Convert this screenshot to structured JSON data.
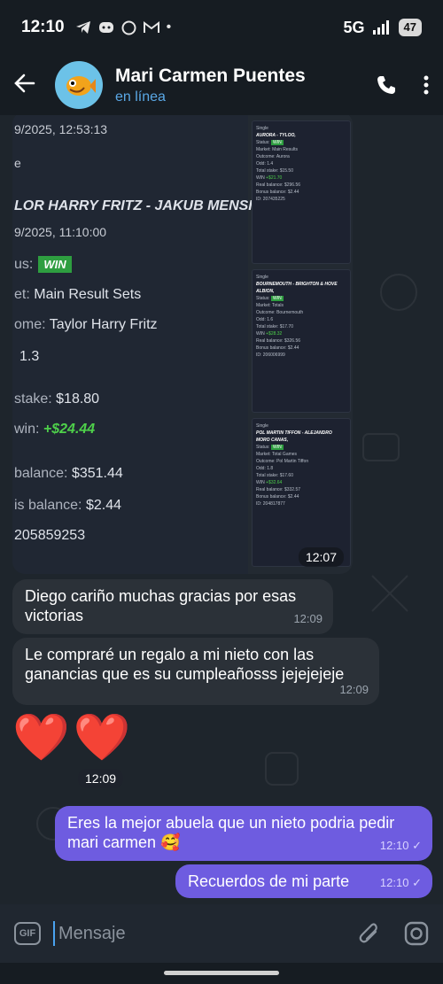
{
  "status_bar": {
    "time": "12:10",
    "network": "5G",
    "battery": "47"
  },
  "header": {
    "title": "Mari Carmen Puentes",
    "subtitle": "en línea"
  },
  "photo": {
    "left_lines": [
      "9/2025, 12:53:13",
      "e",
      "LOR HARRY FRITZ - JAKUB MENSIK,",
      "9/2025, 11:10:00",
      "us:",
      "et:",
      "Main Result Sets",
      "ome:",
      "Taylor Harry Fritz",
      "1.3",
      "stake:",
      "$18.80",
      "win:",
      "+$24.44",
      "balance:",
      "$351.44",
      "is balance:",
      "$2.44",
      "205859253"
    ],
    "win_label": "WIN",
    "time": "12:07",
    "tickets": [
      {
        "title": "AURORA - TYLOO,",
        "market": "Main Results",
        "outcome": "Aurora",
        "odd": "1.4",
        "stake": "$15.50",
        "win": "+$21.70",
        "balance": "$296.56",
        "bonus": "$2.44",
        "id": "207435225"
      },
      {
        "title": "BOURNEMOUTH - BRIGHTON & HOVE ALBION,",
        "market": "Totals",
        "outcome": "Bournemouth",
        "odd": "1.6",
        "stake": "$17.70",
        "win": "+$28.32",
        "balance": "$326.56",
        "bonus": "$2.44",
        "id": "206006999"
      },
      {
        "title": "POL MARTIN TIFFON - ALEJANDRO MORO CANAS,",
        "market": "Total Games",
        "outcome": "Pol Martin Tiffon",
        "odd": "1.8",
        "stake": "$17.60",
        "win": "+$32.64",
        "balance": "$332.57",
        "bonus": "$2.44",
        "id": "204817877"
      }
    ],
    "ticket_labels": {
      "status": "Status:",
      "market": "Market:",
      "outcome": "Outcome:",
      "odd": "Odd:",
      "stake": "Total stake:",
      "win": "WIN",
      "balance": "Real balance:",
      "bonus": "Bonus balance:",
      "id": "ID:",
      "single": "Single"
    }
  },
  "messages": [
    {
      "text": "Diego cariño muchas gracias por esas victorias",
      "time": "12:09"
    },
    {
      "text": "Le compraré un regalo a mi nieto con las ganancias que es su cumpleañosss jejejejeje",
      "time": "12:09"
    },
    {
      "text": "❤️❤️",
      "time": "12:09"
    },
    {
      "text": "Eres la mejor abuela que un nieto podria pedir mari carmen 🥰",
      "time": "12:10"
    },
    {
      "text": "Recuerdos de mi parte",
      "time": "12:10"
    }
  ],
  "input": {
    "placeholder": "Mensaje",
    "gif_label": "GIF"
  },
  "colors": {
    "accent": "#5aa8e6",
    "outgoing": "#6e5ce0",
    "win_green": "#4ed04a"
  }
}
